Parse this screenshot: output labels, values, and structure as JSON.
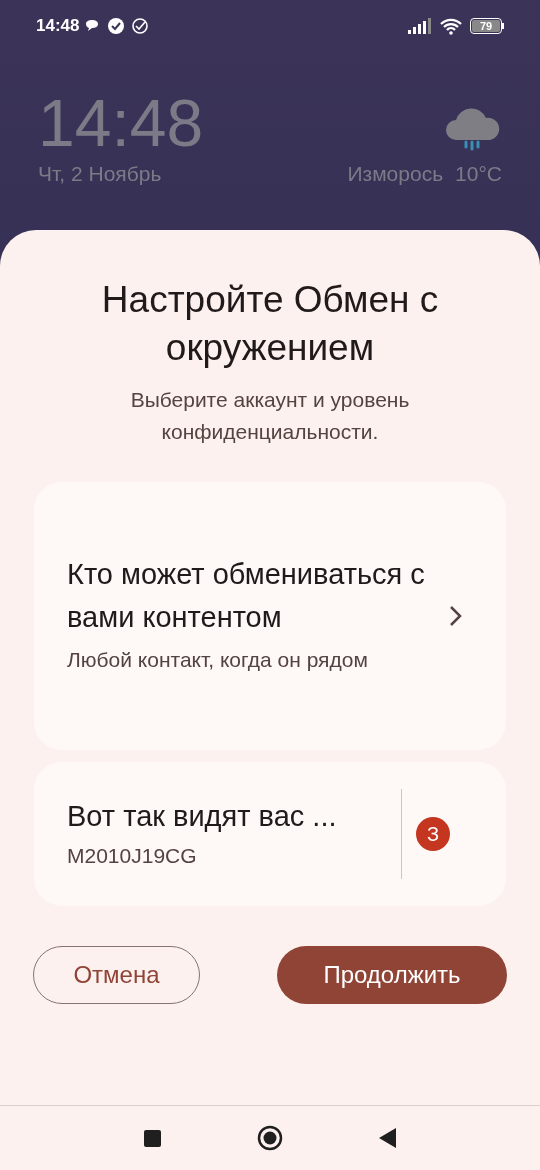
{
  "status_bar": {
    "time": "14:48",
    "battery": "79"
  },
  "lock_screen": {
    "clock": "14:48",
    "date": "Чт, 2 Ноябрь",
    "weather": "Изморось",
    "temperature": "10°C"
  },
  "sheet": {
    "title": "Настройте Обмен с окружением",
    "subtitle": "Выберите аккаунт и уровень конфиденциальности.",
    "visibility": {
      "title": "Кто может обмениваться с вами контентом",
      "subtitle": "Любой контакт, когда он рядом"
    },
    "device": {
      "title": "Вот так видят вас ...",
      "subtitle": "M2010J19CG",
      "avatar": "З"
    },
    "buttons": [
      {
        "label": "Отмена",
        "kind": "outlined"
      },
      {
        "label": "Продолжить",
        "kind": "filled"
      }
    ]
  }
}
